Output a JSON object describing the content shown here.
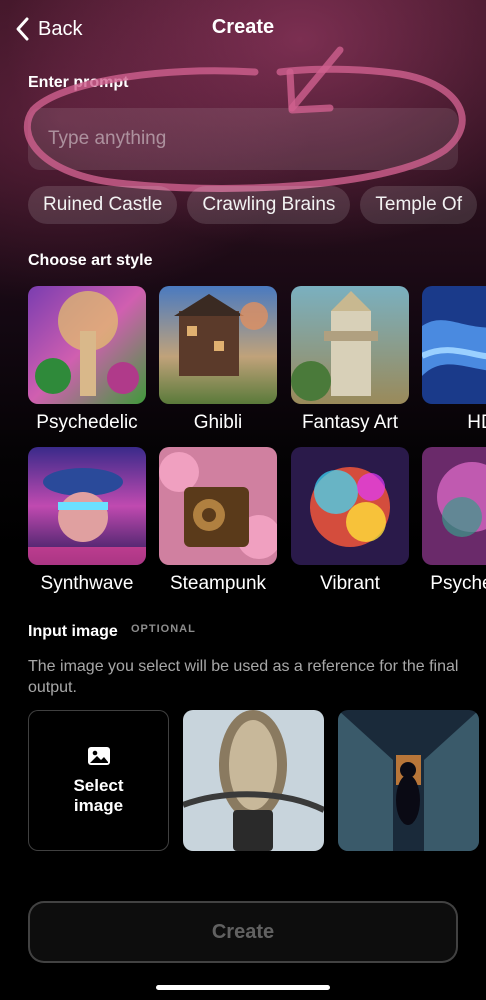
{
  "header": {
    "back_label": "Back",
    "title": "Create"
  },
  "prompt": {
    "label": "Enter prompt",
    "placeholder": "Type anything",
    "value": ""
  },
  "suggestions": [
    "Ruined Castle",
    "Crawling Brains",
    "Temple Of"
  ],
  "art_style": {
    "label": "Choose art style",
    "styles": [
      "Psychedelic",
      "Ghibli",
      "Fantasy Art",
      "HD",
      "Synthwave",
      "Steampunk",
      "Vibrant",
      "Psychedelic"
    ]
  },
  "input_image": {
    "title": "Input image",
    "optional": "OPTIONAL",
    "description": "The image you select will be used as a reference for the final output.",
    "select_label": "Select image"
  },
  "create_label": "Create",
  "colors": {
    "annotation": "#d0608f",
    "button_border": "#3a3a3a"
  }
}
